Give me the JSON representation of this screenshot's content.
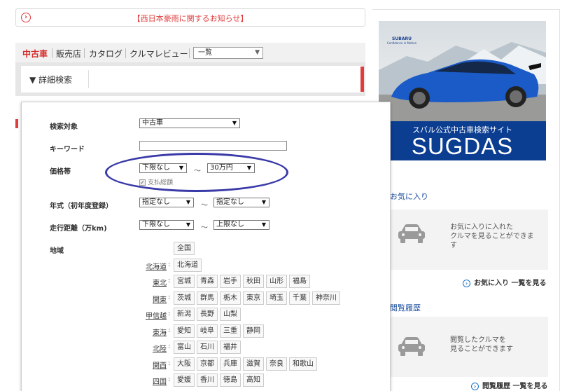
{
  "notice": {
    "text": "【西日本豪雨に関するお知らせ】"
  },
  "tabs": [
    "中古車",
    "販売店",
    "カタログ",
    "クルマレビュー"
  ],
  "tab_select": "一覧",
  "detail_search": "▼ 詳細検索",
  "form": {
    "target_label": "検索対象",
    "target_value": "中古車",
    "keyword_label": "キーワード",
    "price_label": "価格帯",
    "price_min": "下限なし",
    "price_max": "30万円",
    "tilde": "～",
    "total_payment": "支払総額",
    "year_label": "年式（初年度登録）",
    "year_min": "指定なし",
    "year_max": "指定なし",
    "mileage_label": "走行距離（万km)",
    "mileage_min": "下限なし",
    "mileage_max": "上限なし",
    "area_label": "地域"
  },
  "regions": [
    {
      "name": "",
      "prefs": [
        "全国"
      ]
    },
    {
      "name": "北海道",
      "prefs": [
        "北海道"
      ]
    },
    {
      "name": "東北",
      "prefs": [
        "宮城",
        "青森",
        "岩手",
        "秋田",
        "山形",
        "福島"
      ]
    },
    {
      "name": "関東",
      "prefs": [
        "茨城",
        "群馬",
        "栃木",
        "東京",
        "埼玉",
        "千葉",
        "神奈川"
      ]
    },
    {
      "name": "甲信越",
      "prefs": [
        "新潟",
        "長野",
        "山梨"
      ]
    },
    {
      "name": "東海",
      "prefs": [
        "愛知",
        "岐阜",
        "三重",
        "静岡"
      ]
    },
    {
      "name": "北陸",
      "prefs": [
        "富山",
        "石川",
        "福井"
      ]
    },
    {
      "name": "関西",
      "prefs": [
        "大阪",
        "京都",
        "兵庫",
        "滋賀",
        "奈良",
        "和歌山"
      ]
    },
    {
      "name": "四国",
      "prefs": [
        "愛媛",
        "香川",
        "徳島",
        "高知"
      ]
    }
  ],
  "banner": {
    "brand": "SUBARU",
    "tagline": "Confidence in Motion",
    "subtitle": "スバル公式中古車検索サイト",
    "title": "SUGDAS"
  },
  "favorites": {
    "title": "お気に入り",
    "message_1": "お気に入りに入れた",
    "message_2": "クルマを見ることができま",
    "message_3": "す",
    "link": "お気に入り 一覧を見る"
  },
  "history": {
    "title": "閲覧履歴",
    "message_1": "閲覧したクルマを",
    "message_2": "見ることができます",
    "link": "閲覧履歴 一覧を見る"
  },
  "colors": {
    "accent": "#e03c3c",
    "annotation": "#3a3aa8",
    "link": "#1a4c9c",
    "banner": "#0b3d91"
  }
}
